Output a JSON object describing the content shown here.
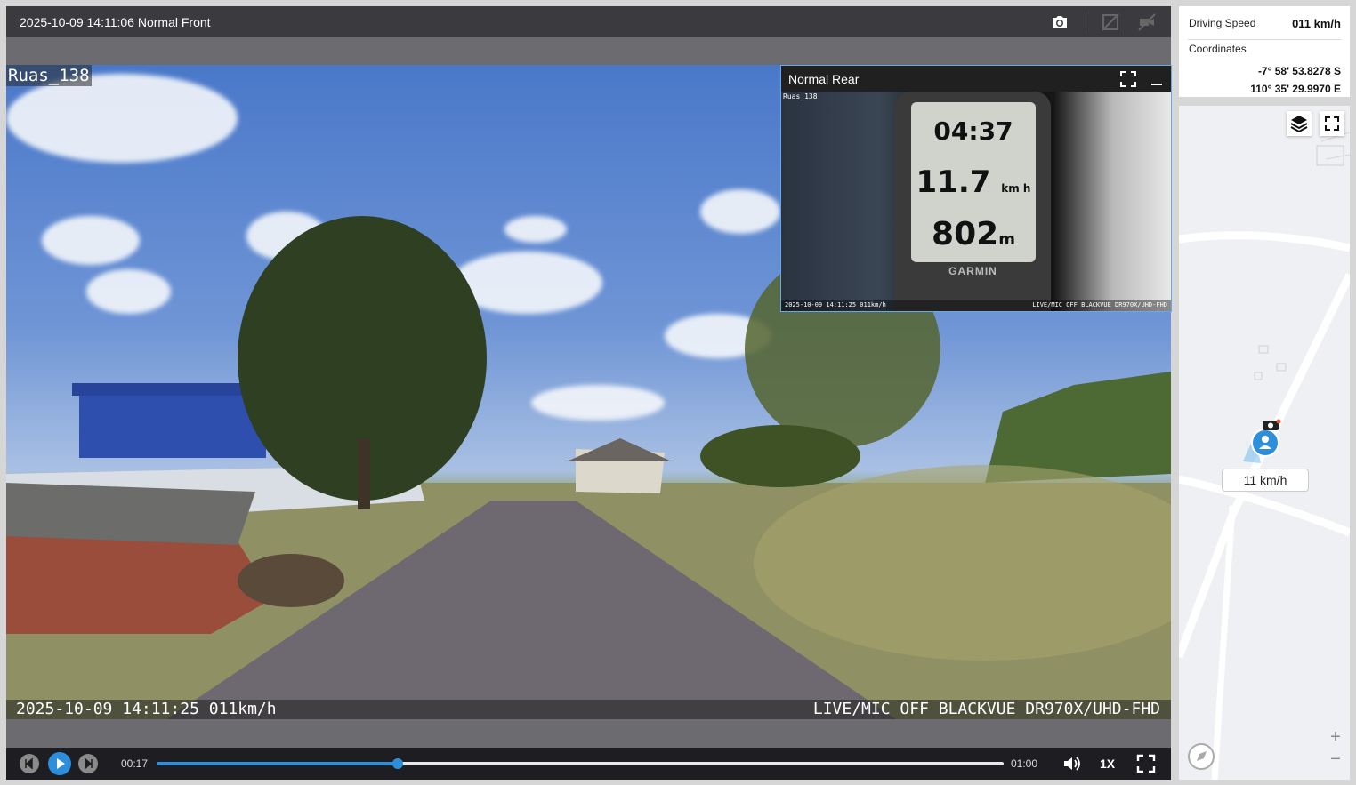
{
  "header": {
    "title": "2025-10-09 14:11:06 Normal Front",
    "icons": [
      "camera-icon",
      "hide-overlay-icon",
      "mute-camera-icon"
    ]
  },
  "video_overlay": {
    "top_left": "Ruas_138",
    "bottom_left": "2025-10-09 14:11:25 011km/h",
    "bottom_right": "LIVE/MIC OFF BLACKVUE DR970X/UHD-FHD"
  },
  "pip": {
    "title": "Normal Rear",
    "label": "Ruas_138",
    "device_time": "04:37",
    "device_speed": "11.7",
    "device_speed_unit": "km h",
    "device_distance": "802",
    "device_distance_unit": "m",
    "device_brand": "GARMIN",
    "footer_left": "2025-10-09 14:11:25 011km/h",
    "footer_right": "LIVE/MIC OFF BLACKVUE DR970X/UHD-FHD"
  },
  "controls": {
    "current_time": "00:17",
    "total_time": "01:00",
    "progress": 0.285,
    "playback_rate": "1X"
  },
  "info": {
    "speed_label": "Driving Speed",
    "speed_value": "011 km/h",
    "coord_label": "Coordinates",
    "lat": "-7° 58' 53.8278 S",
    "lon": "110° 35' 29.9970 E"
  },
  "map": {
    "speed_tag": "11 km/h",
    "zoom_in": "+",
    "zoom_out": "−"
  },
  "colors": {
    "accent": "#2d8fdb",
    "player_bg": "#6b6b70",
    "topbar_bg": "#3a3a3f",
    "controls_bg": "#1d1d22"
  }
}
